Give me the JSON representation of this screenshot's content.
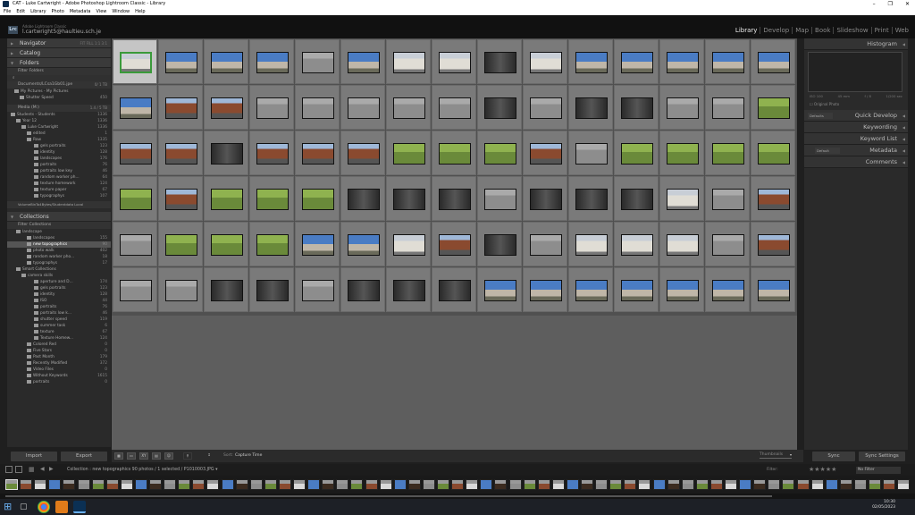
{
  "window": {
    "title": "CAT - Luke Cartwright - Adobe Photoshop Lightroom Classic - Library",
    "controls": [
      "–",
      "❐",
      "✕"
    ]
  },
  "menu": [
    "File",
    "Edit",
    "Library",
    "Photo",
    "Metadata",
    "View",
    "Window",
    "Help"
  ],
  "identity": {
    "badge": "Lrc",
    "sub": "Adobe Lightroom Classic",
    "email": "l.cartwright5@haultieu.sch.je"
  },
  "modules": [
    "Library",
    "Develop",
    "Map",
    "Book",
    "Slideshow",
    "Print",
    "Web"
  ],
  "left": {
    "navigator": {
      "label": "Navigator",
      "extra": "FIT  FILL  1:1  3:1"
    },
    "catalog": "Catalog",
    "folders": "Folders",
    "filter_folders": "Filter Folders",
    "volumes": [
      {
        "name": "Documents/LCsa1Gb01.jpe",
        "count": "0/ 1 TB"
      },
      {
        "name": "Media (M:)",
        "count": "1.4 / 5 TB"
      }
    ],
    "pictures": [
      {
        "name": "My Pictures - My Pictures",
        "count": ""
      },
      {
        "name": "Shutter Speed",
        "count": "450"
      }
    ],
    "folder_rows": [
      {
        "name": "Students - Students",
        "count": "1336",
        "indent": 4
      },
      {
        "name": "Year 12",
        "count": "1336",
        "indent": 10
      },
      {
        "name": "Luke Cartwright",
        "count": "1336",
        "indent": 16
      },
      {
        "name": "edited",
        "count": "1",
        "indent": 22
      },
      {
        "name": "Raw",
        "count": "1335",
        "indent": 22
      },
      {
        "name": "gels portraits",
        "count": "123",
        "indent": 30
      },
      {
        "name": "identity",
        "count": "128",
        "indent": 30
      },
      {
        "name": "landscapes",
        "count": "176",
        "indent": 30
      },
      {
        "name": "portraits",
        "count": "76",
        "indent": 30
      },
      {
        "name": "portraits low key",
        "count": "46",
        "indent": 30
      },
      {
        "name": "random worker ph...",
        "count": "64",
        "indent": 30
      },
      {
        "name": "texture homework",
        "count": "124",
        "indent": 30
      },
      {
        "name": "texture paper",
        "count": "67",
        "indent": 30
      },
      {
        "name": "typographys",
        "count": "107",
        "indent": 30
      }
    ],
    "volume_footer": "VolumeBinTo4Bytes/Studentdata Local",
    "collections": "Collections",
    "filter_collections": "Filter Collections",
    "collection_rows": [
      {
        "name": "landscape",
        "count": "",
        "indent": 10,
        "sel": false
      },
      {
        "name": "landscapes",
        "count": "155",
        "indent": 22,
        "sel": false
      },
      {
        "name": "new topographics",
        "count": "90",
        "indent": 22,
        "sel": true
      },
      {
        "name": "photo walk",
        "count": "402",
        "indent": 22,
        "sel": false
      },
      {
        "name": "random worker pho...",
        "count": "18",
        "indent": 22,
        "sel": false
      },
      {
        "name": "typographys",
        "count": "17",
        "indent": 22,
        "sel": false
      },
      {
        "name": "Smart Collections",
        "count": "",
        "indent": 10,
        "sel": false
      },
      {
        "name": "camera skills",
        "count": "",
        "indent": 16,
        "sel": false
      },
      {
        "name": "aperture and D...",
        "count": "174",
        "indent": 30,
        "sel": false
      },
      {
        "name": "gels portraits",
        "count": "123",
        "indent": 30,
        "sel": false
      },
      {
        "name": "identity",
        "count": "128",
        "indent": 30,
        "sel": false
      },
      {
        "name": "ISO",
        "count": "44",
        "indent": 30,
        "sel": false
      },
      {
        "name": "portraits",
        "count": "76",
        "indent": 30,
        "sel": false
      },
      {
        "name": "portraits low k...",
        "count": "46",
        "indent": 30,
        "sel": false
      },
      {
        "name": "shutter speed",
        "count": "119",
        "indent": 30,
        "sel": false
      },
      {
        "name": "summer task",
        "count": "6",
        "indent": 30,
        "sel": false
      },
      {
        "name": "texture",
        "count": "67",
        "indent": 30,
        "sel": false
      },
      {
        "name": "Texture Homew...",
        "count": "124",
        "indent": 30,
        "sel": false
      },
      {
        "name": "Colored Red",
        "count": "0",
        "indent": 22,
        "sel": false
      },
      {
        "name": "Five Stars",
        "count": "0",
        "indent": 22,
        "sel": false
      },
      {
        "name": "Past Month",
        "count": "179",
        "indent": 22,
        "sel": false
      },
      {
        "name": "Recently Modified",
        "count": "372",
        "indent": 22,
        "sel": false
      },
      {
        "name": "Video Files",
        "count": "0",
        "indent": 22,
        "sel": false
      },
      {
        "name": "Without Keywords",
        "count": "1615",
        "indent": 22,
        "sel": false
      },
      {
        "name": "portraits",
        "count": "0",
        "indent": 22,
        "sel": false
      }
    ],
    "import": "Import",
    "export": "Export"
  },
  "toolbar": {
    "sort_label": "Sort:",
    "sort_value": "Capture Time",
    "thumbnails": "Thumbnails"
  },
  "right": {
    "histogram": "Histogram",
    "histo_info": [
      "ISO 100",
      "45 mm",
      "f / 8",
      "1/200 sec"
    ],
    "original_photo": "Original Photo",
    "preset": "Defaults",
    "panels": [
      "Quick Develop",
      "Keywording",
      "Keyword List",
      "Metadata",
      "Comments"
    ],
    "meta_preset": "Default",
    "sync": "Sync",
    "sync_settings": "Sync Settings"
  },
  "filmstrip": {
    "source": "Collection : new topographics    90 photos / 1 selected / P1010003.JPG ▾",
    "filter_label": "Filter:",
    "stars": "★★★★★",
    "filter_value": "No Filter"
  },
  "clock": {
    "time": "10:30",
    "date": "02/05/2023"
  },
  "colors": {
    "sky": "#4a7cc4",
    "dark": "#3b2b1f",
    "grey": "#8d8d8d",
    "green": "#6a8a3a",
    "brick": "#8a4a2f",
    "white": "#d9d9d9",
    "accent": "#eeeeee"
  },
  "grid_palette": [
    [
      "white",
      "sky",
      "sky",
      "sky",
      "grey",
      "sky",
      "white",
      "white",
      "dark",
      "white",
      "sky",
      "sky",
      "sky",
      "sky",
      "sky"
    ],
    [
      "sky",
      "brick",
      "brick",
      "grey",
      "grey",
      "grey",
      "grey",
      "grey",
      "dark",
      "grey",
      "dark",
      "dark",
      "grey",
      "grey",
      "green"
    ],
    [
      "brick",
      "brick",
      "dark",
      "brick",
      "brick",
      "brick",
      "green",
      "green",
      "green",
      "brick",
      "grey",
      "green",
      "green",
      "green",
      "green"
    ],
    [
      "green",
      "brick",
      "green",
      "green",
      "green",
      "dark",
      "dark",
      "dark",
      "grey",
      "dark",
      "dark",
      "dark",
      "white",
      "grey",
      "brick"
    ],
    [
      "grey",
      "green",
      "green",
      "green",
      "sky",
      "sky",
      "white",
      "brick",
      "dark",
      "grey",
      "white",
      "white",
      "white",
      "grey",
      "brick"
    ],
    [
      "grey",
      "grey",
      "dark",
      "dark",
      "grey",
      "dark",
      "dark",
      "dark",
      "sky",
      "sky",
      "sky",
      "sky",
      "sky",
      "sky",
      "sky"
    ]
  ]
}
